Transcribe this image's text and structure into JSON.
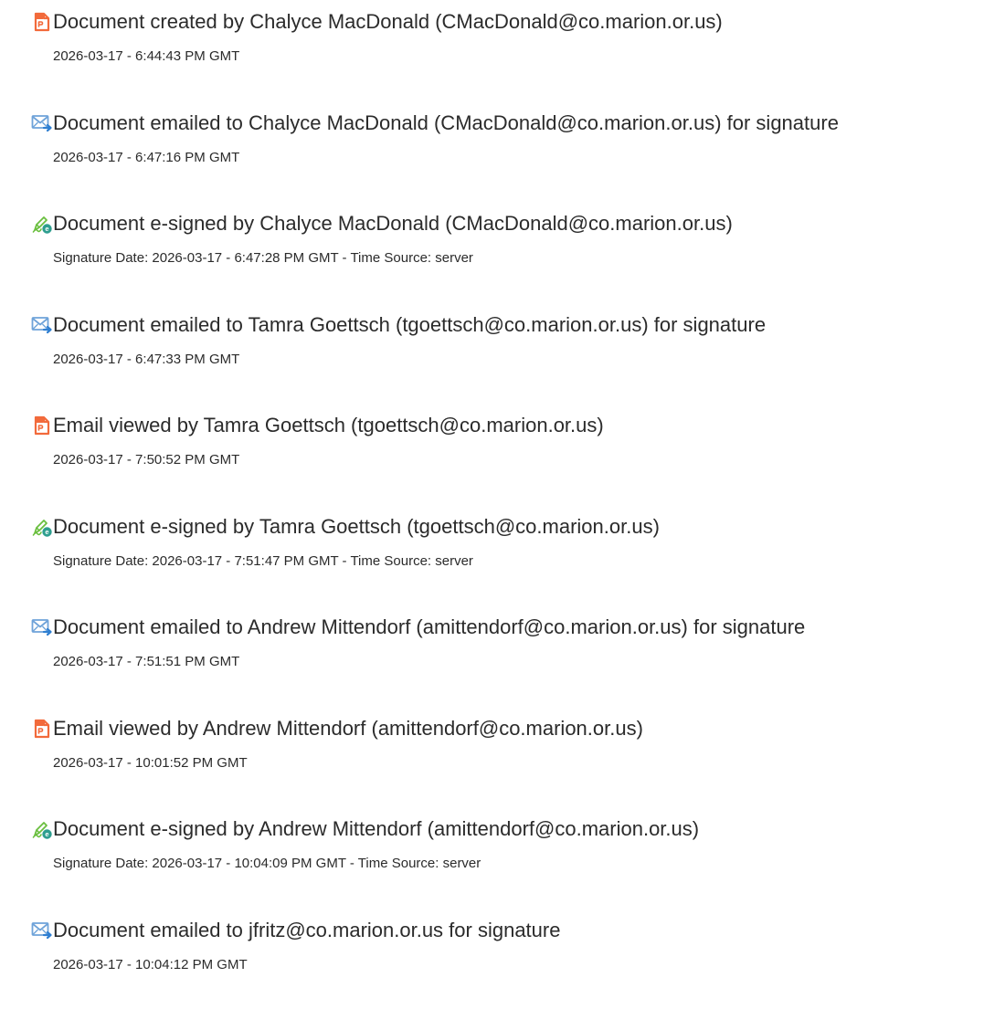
{
  "colors": {
    "created_icon": "#f26a3b",
    "email_icon_envelope": "#6fa3d9",
    "email_icon_arrow": "#2f7fd1",
    "signed_icon_pen": "#6abf3f",
    "signed_icon_badge": "#2e9e8f",
    "text": "#2b2b2b"
  },
  "events": [
    {
      "icon": "document-created-icon",
      "title": "Document created by Chalyce MacDonald (CMacDonald@co.marion.or.us)",
      "detail": "2026-03-17 - 6:44:43 PM GMT"
    },
    {
      "icon": "document-emailed-icon",
      "title": "Document emailed to Chalyce MacDonald (CMacDonald@co.marion.or.us) for signature",
      "detail": "2026-03-17 - 6:47:16 PM GMT"
    },
    {
      "icon": "document-esigned-icon",
      "title": "Document e-signed by Chalyce MacDonald (CMacDonald@co.marion.or.us)",
      "detail": "Signature Date: 2026-03-17 - 6:47:28 PM GMT - Time Source: server"
    },
    {
      "icon": "document-emailed-icon",
      "title": "Document emailed to Tamra Goettsch (tgoettsch@co.marion.or.us) for signature",
      "detail": "2026-03-17 - 6:47:33 PM GMT"
    },
    {
      "icon": "email-viewed-icon",
      "title": "Email viewed by Tamra Goettsch (tgoettsch@co.marion.or.us)",
      "detail": "2026-03-17 - 7:50:52 PM GMT"
    },
    {
      "icon": "document-esigned-icon",
      "title": "Document e-signed by Tamra Goettsch (tgoettsch@co.marion.or.us)",
      "detail": "Signature Date: 2026-03-17 - 7:51:47 PM GMT - Time Source: server"
    },
    {
      "icon": "document-emailed-icon",
      "title": "Document emailed to Andrew Mittendorf (amittendorf@co.marion.or.us) for signature",
      "detail": "2026-03-17 - 7:51:51 PM GMT"
    },
    {
      "icon": "email-viewed-icon",
      "title": "Email viewed by Andrew Mittendorf (amittendorf@co.marion.or.us)",
      "detail": "2026-03-17 - 10:01:52 PM GMT"
    },
    {
      "icon": "document-esigned-icon",
      "title": "Document e-signed by Andrew Mittendorf (amittendorf@co.marion.or.us)",
      "detail": "Signature Date: 2026-03-17 - 10:04:09 PM GMT - Time Source: server"
    },
    {
      "icon": "document-emailed-icon",
      "title": "Document emailed to jfritz@co.marion.or.us for signature",
      "detail": "2026-03-17 - 10:04:12 PM GMT"
    }
  ]
}
